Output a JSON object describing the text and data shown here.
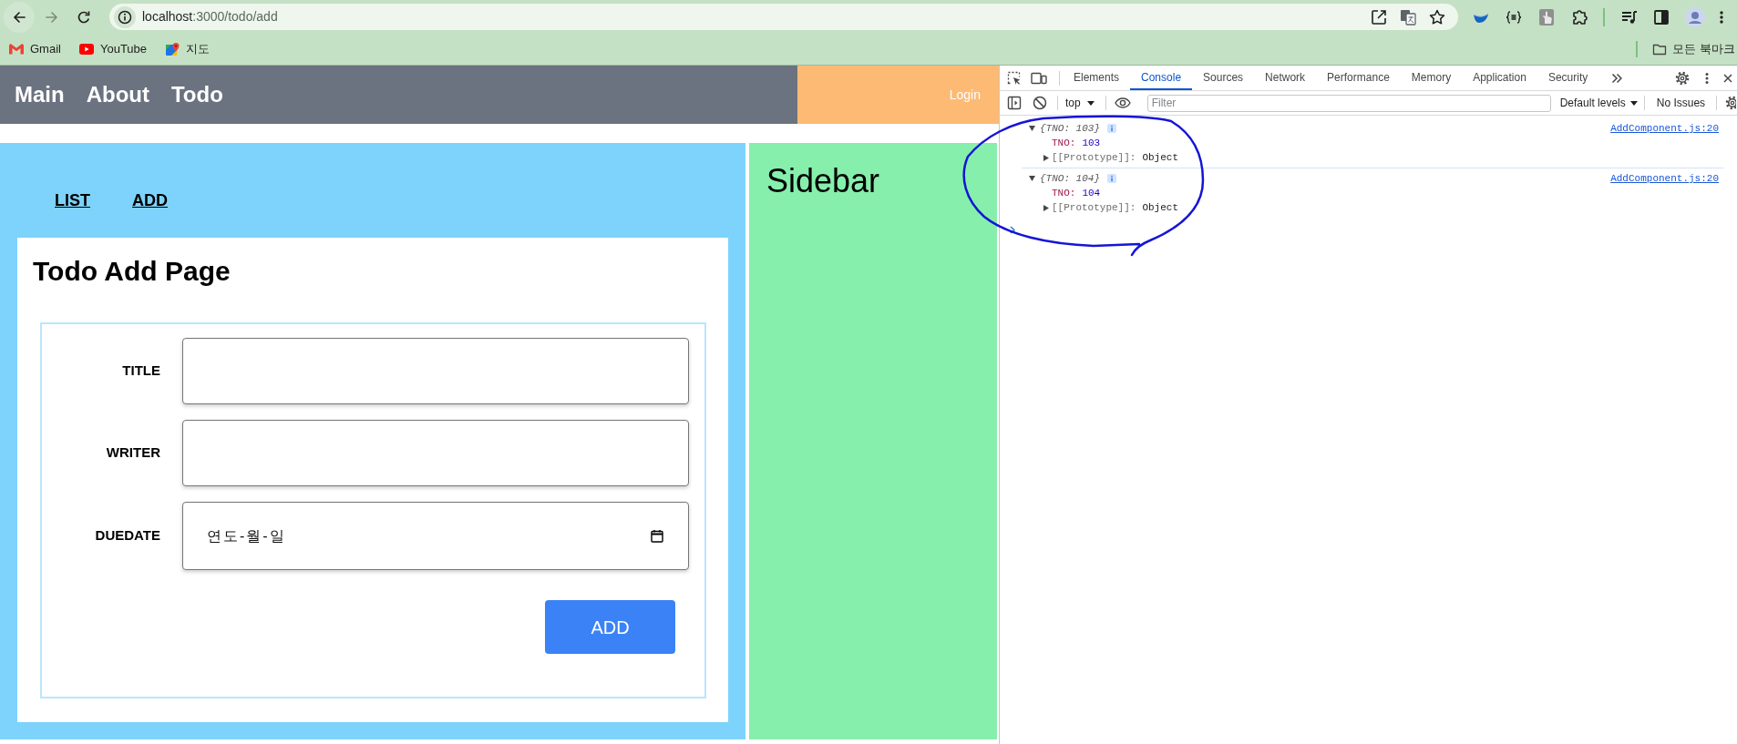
{
  "browser": {
    "url_host": "localhost",
    "url_path": ":3000/todo/add",
    "bookmarks": [
      {
        "label": "Gmail",
        "kind": "gmail"
      },
      {
        "label": "YouTube",
        "kind": "youtube"
      },
      {
        "label": "지도",
        "kind": "maps"
      }
    ],
    "all_bookmarks": "모든 북마크"
  },
  "nav": {
    "links": [
      "Main",
      "About",
      "Todo"
    ],
    "login": "Login"
  },
  "subnav": [
    "LIST",
    "ADD"
  ],
  "page": {
    "title": "Todo Add Page",
    "fields": [
      {
        "label": "TITLE",
        "kind": "text"
      },
      {
        "label": "WRITER",
        "kind": "text"
      },
      {
        "label": "DUEDATE",
        "kind": "date",
        "placeholder": "연도-월-일"
      }
    ],
    "button": "ADD"
  },
  "sidebar": {
    "title": "Sidebar"
  },
  "devtools": {
    "tabs": [
      {
        "label": "Elements",
        "selected": false
      },
      {
        "label": "Console",
        "selected": true
      },
      {
        "label": "Sources",
        "selected": false
      },
      {
        "label": "Network",
        "selected": false
      },
      {
        "label": "Performance",
        "selected": false
      },
      {
        "label": "Memory",
        "selected": false
      },
      {
        "label": "Application",
        "selected": false
      },
      {
        "label": "Security",
        "selected": false
      }
    ],
    "context": "top",
    "filter": {
      "placeholder": "Filter"
    },
    "levels": "Default levels",
    "issues": "No Issues",
    "messages": [
      {
        "summary": "{TNO: 103}",
        "expanded": true,
        "source": "AddComponent.js:20",
        "properties": [
          {
            "key": "TNO:",
            "value": "103"
          }
        ],
        "prototype": {
          "key": "[[Prototype]]:",
          "value": "Object",
          "expanded": false
        }
      },
      {
        "summary": "{TNO: 104}",
        "expanded": true,
        "source": "AddComponent.js:20",
        "properties": [
          {
            "key": "TNO:",
            "value": "104"
          }
        ],
        "prototype": {
          "key": "[[Prototype]]:",
          "value": "Object",
          "expanded": false
        }
      }
    ]
  }
}
